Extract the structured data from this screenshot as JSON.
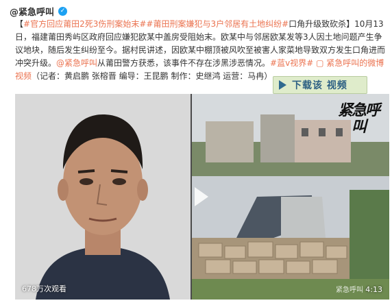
{
  "header": {
    "username": "@紧急呼叫",
    "verified_icon": "verified-badge-icon"
  },
  "post": {
    "topic1": "#官方回应莆田2死3伤刑案始末#",
    "topic2": "#莆田刑案嫌犯与3户邻居有土地纠纷#",
    "body1": "口角升级致砍杀】10月13日，福建莆田秀屿区政府回应嫌犯欧某中盖房受阻始末。欧某中与邻居欧某发等3人因土地问题产生争议地块，随后发生纠纷至今。据村民讲述，因欧某中棚顶被风吹至被害人家菜地导致双方发生口角进而冲突升级。",
    "mention": "@紧急呼叫",
    "body2": "从莆田警方获悉，该事件不存在涉黑涉恶情况。",
    "topic3": "#蓝v视界#",
    "video_link": "紧急呼叫的微博视频",
    "credits": "（记者：黄启鹏 张榕晋 编导：王昆鹏 制作：史继鸿 运营：马冉）"
  },
  "download_button": {
    "label": "下载该 视频"
  },
  "video": {
    "views": "678万次观看",
    "duration": "4:13",
    "watermark": "紧急呼叫",
    "logo": "紧急呼叫"
  },
  "colors": {
    "accent": "#eb7350",
    "verified": "#1da1f2",
    "download_bg": "#dfeccb"
  }
}
